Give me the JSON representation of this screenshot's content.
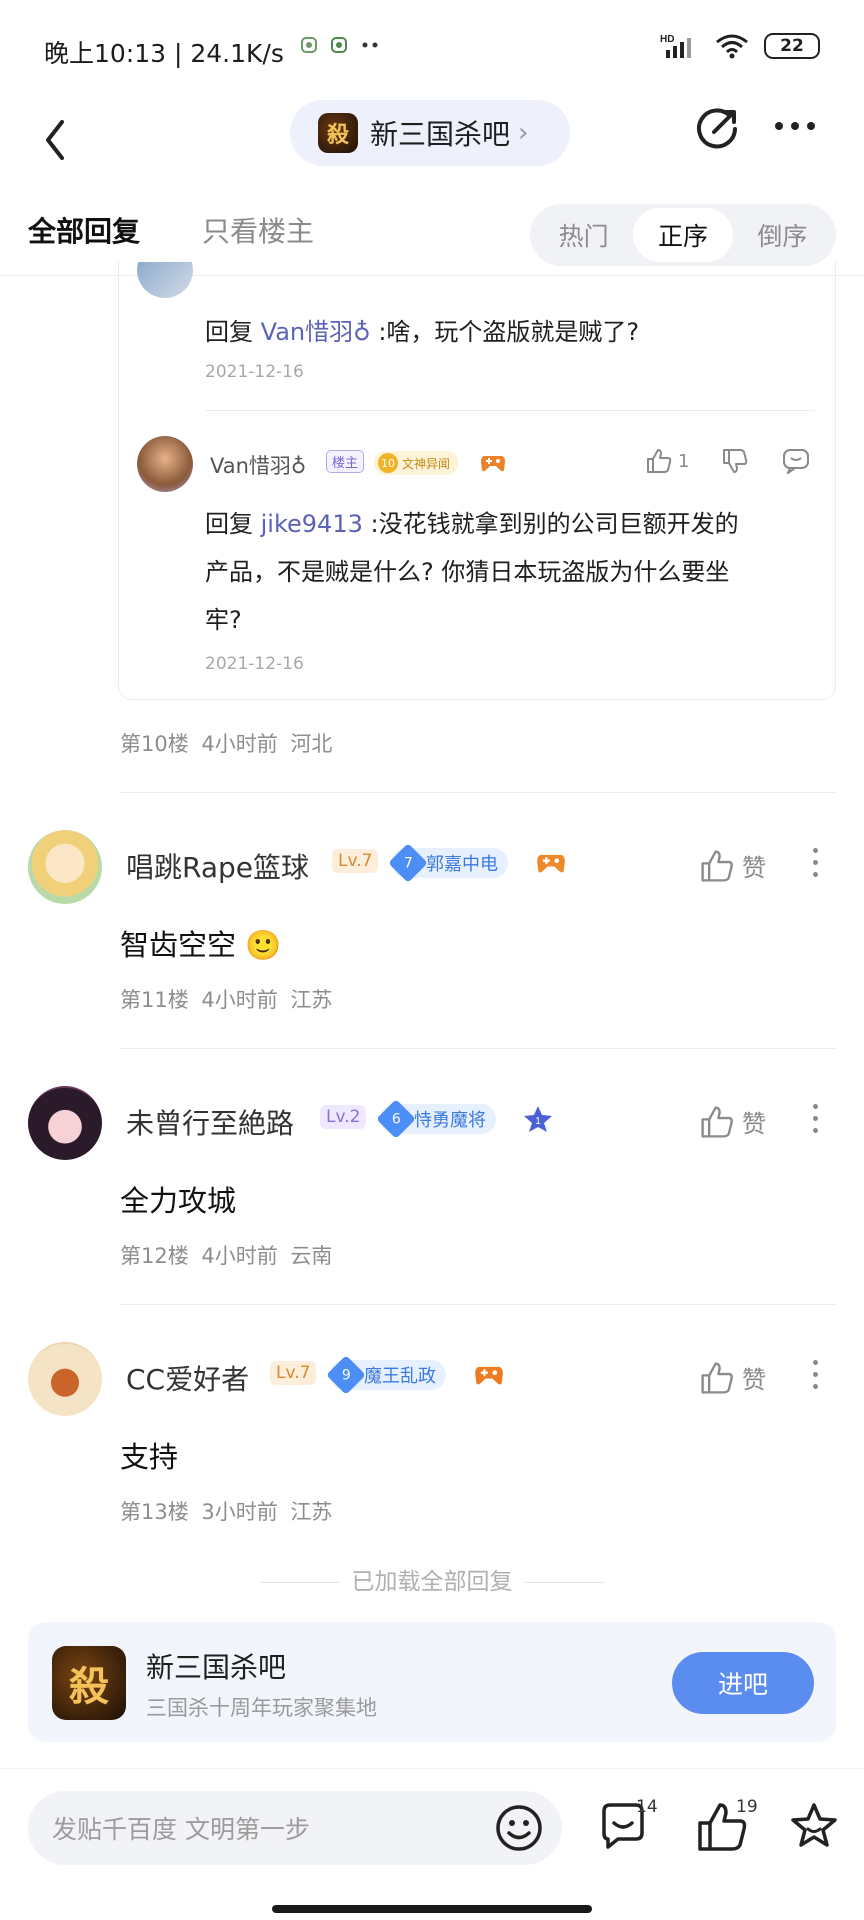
{
  "status_bar": {
    "time": "晚上10:13 | 24.1K/s",
    "hd": "HD",
    "battery": "22"
  },
  "nav": {
    "forum_name": "新三国杀吧",
    "forum_logo_char": "殺"
  },
  "tabs": {
    "all": "全部回复",
    "op_only": "只看楼主",
    "sort": [
      "热门",
      "正序",
      "倒序"
    ],
    "sort_active": "正序"
  },
  "sub_replies": [
    {
      "reply_prefix": "回复 ",
      "mention": "Van惜羽♁",
      "text": " :啥，玩个盗版就是贼了?",
      "date": "2021-12-16"
    },
    {
      "author": "Van惜羽♁",
      "owner_tag": "楼主",
      "gold_level": "10",
      "gold_title": "文神异闻",
      "likes": "1",
      "reply_prefix": "回复 ",
      "mention": "jike9413",
      "text_line1": " :没花钱就拿到别的公司巨额开发的",
      "text_line2": "产品，不是贼是什么? 你猜日本玩盗版为什么要坐",
      "text_line3": "牢?",
      "date": "2021-12-16"
    }
  ],
  "floor10": {
    "meta": "第10楼  4小时前  河北"
  },
  "posts": [
    {
      "author": "唱跳Rape篮球",
      "level": "Lv.7",
      "badge_num": "7",
      "badge_title": "郭嘉中电",
      "like_label": "赞",
      "content": "智齿空空 🙂",
      "meta": "第11楼  4小时前  江苏"
    },
    {
      "author": "未曾行至絶路",
      "level": "Lv.2",
      "badge_num": "6",
      "badge_title": "恃勇魔将",
      "like_label": "赞",
      "content": "全力攻城",
      "meta": "第12楼  4小时前  云南"
    },
    {
      "author": "CC爱好者",
      "level": "Lv.7",
      "badge_num": "9",
      "badge_title": "魔王乱政",
      "like_label": "赞",
      "content": "支持",
      "meta": "第13楼  3小时前  江苏"
    }
  ],
  "loaded_all": "已加载全部回复",
  "forum_card": {
    "title": "新三国杀吧",
    "subtitle": "三国杀十周年玩家聚集地",
    "join": "进吧",
    "logo_char": "殺"
  },
  "bottom_bar": {
    "composer_placeholder": "发贴千百度 文明第一步",
    "comment_count": "14",
    "like_count": "19"
  },
  "colors": {
    "accent": "#5b8cf0",
    "mention": "#5a63b5",
    "badge_blue": "#4c8df6",
    "level_orange": "#d7892f",
    "level_purple": "#8b6fd8"
  }
}
